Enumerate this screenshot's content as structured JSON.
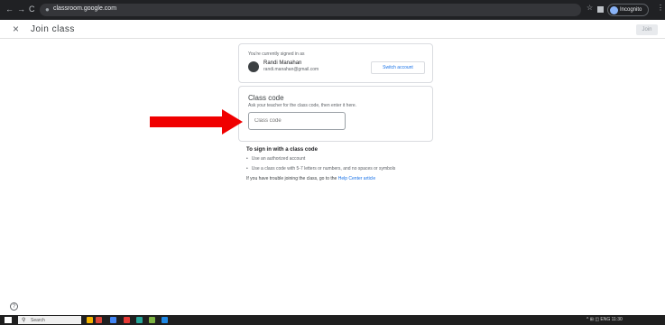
{
  "browser": {
    "url": "classroom.google.com",
    "profile_label": "Incognito",
    "nav_back": "←",
    "nav_forward": "→",
    "nav_reload": "C",
    "lock_icon": "lock-icon",
    "star": "☆",
    "menu": "⋮"
  },
  "appbar": {
    "close_symbol": "×",
    "title": "Join class",
    "join_label": "Join"
  },
  "account_card": {
    "signed_in_text": "You're currently signed in as",
    "user_name": "Randi Manahan",
    "user_email": "randi.manahan@gmail.com",
    "switch_label": "Switch account"
  },
  "code_card": {
    "title": "Class code",
    "help": "Ask your teacher for the class code, then enter it here.",
    "placeholder": "Class code"
  },
  "instructions": {
    "heading": "To sign in with a class code",
    "items": [
      "Use an authorized account",
      "Use a class code with 5-7 letters or numbers, and no spaces or symbols"
    ],
    "footer_text": "If you have trouble joining the class, go to the ",
    "footer_link": "Help Center article"
  },
  "help_symbol": "?",
  "taskbar": {
    "search_placeholder": "Search",
    "search_icon": "⚲",
    "tray_text": "^ ⊞ ◫ ENG 11:30"
  },
  "colors": {
    "arrow": "#f00000",
    "link": "#1a73e8",
    "chrome_bg": "#202124"
  }
}
